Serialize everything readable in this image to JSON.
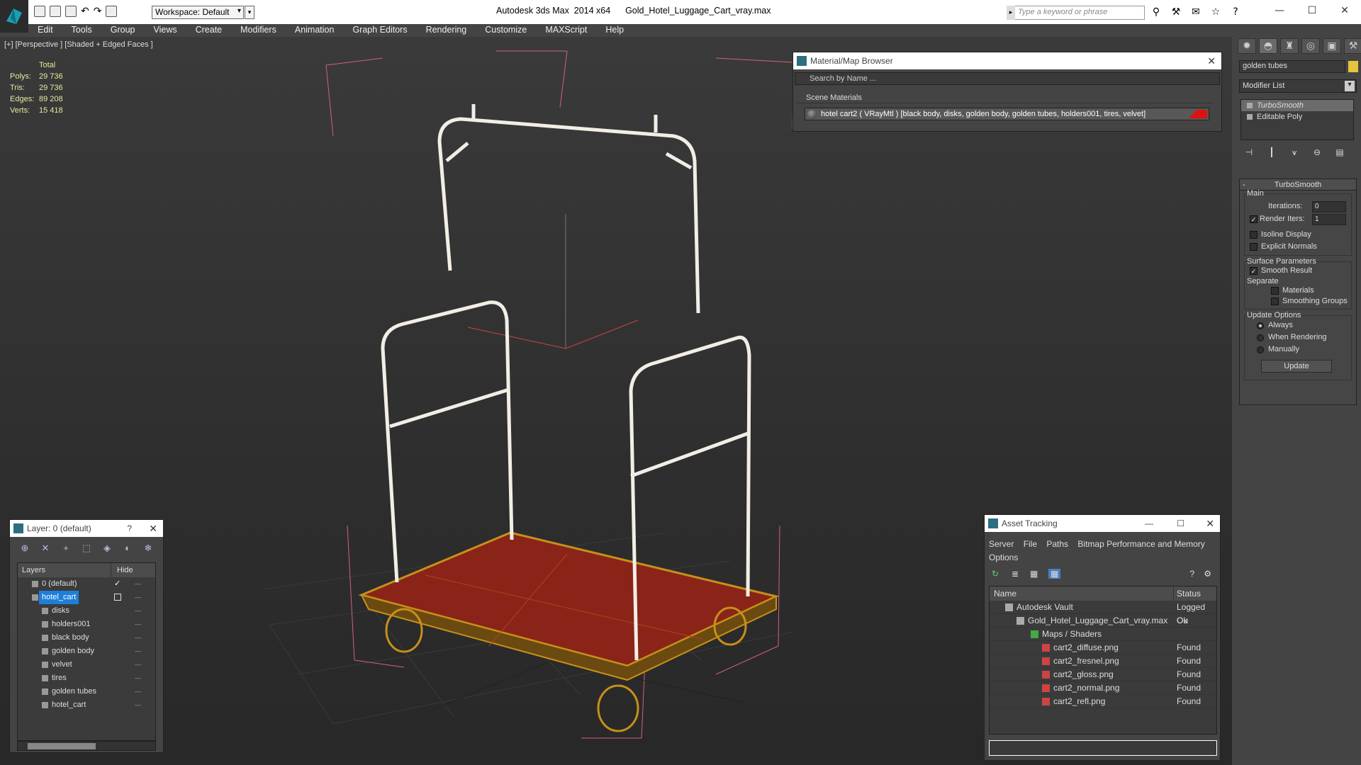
{
  "titlebar": {
    "workspace": "Workspace: Default",
    "app": "Autodesk 3ds Max  2014 x64",
    "file": "Gold_Hotel_Luggage_Cart_vray.max",
    "search_placeholder": "Type a keyword or phrase"
  },
  "menu": [
    "Edit",
    "Tools",
    "Group",
    "Views",
    "Create",
    "Modifiers",
    "Animation",
    "Graph Editors",
    "Rendering",
    "Customize",
    "MAXScript",
    "Help"
  ],
  "viewport": {
    "label": "[+] [Perspective ] [Shaded + Edged Faces ]",
    "stats_header": "Total",
    "stats": [
      {
        "k": "Polys:",
        "v": "29 736"
      },
      {
        "k": "Tris:",
        "v": "29 736"
      },
      {
        "k": "Edges:",
        "v": "89 208"
      },
      {
        "k": "Verts:",
        "v": "15 418"
      }
    ]
  },
  "command_panel": {
    "object_name": "golden tubes",
    "object_color": "#e6c53b",
    "modifier_list": "Modifier List",
    "stack": [
      "TurboSmooth",
      "Editable Poly"
    ],
    "rollout_title": "TurboSmooth",
    "main_label": "Main",
    "iterations_label": "Iterations:",
    "iterations_value": "0",
    "render_iters_label": "Render Iters:",
    "render_iters_value": "1",
    "isoline": "Isoline Display",
    "explicit": "Explicit Normals",
    "surface_label": "Surface Parameters",
    "smooth_result": "Smooth Result",
    "separate_label": "Separate",
    "materials": "Materials",
    "smoothing_groups": "Smoothing Groups",
    "update_label": "Update Options",
    "always": "Always",
    "when_rendering": "When Rendering",
    "manually": "Manually",
    "update_btn": "Update"
  },
  "material_browser": {
    "title": "Material/Map Browser",
    "search": "Search by Name ...",
    "section": "Scene Materials",
    "material": "hotel cart2  ( VRayMtl ) [black body, disks, golden body, golden tubes, holders001, tires, velvet]"
  },
  "layer_window": {
    "title": "Layer: 0 (default)",
    "help": "?",
    "col_layers": "Layers",
    "col_hide": "Hide",
    "rows": [
      "0 (default)",
      "hotel_cart",
      "disks",
      "holders001",
      "black body",
      "golden body",
      "velvet",
      "tires",
      "golden tubes",
      "hotel_cart"
    ]
  },
  "asset_tracking": {
    "title": "Asset Tracking",
    "menu": [
      "Server",
      "File",
      "Paths",
      "Bitmap Performance and Memory",
      "Options"
    ],
    "col_name": "Name",
    "col_status": "Status",
    "rows": [
      {
        "name": "Autodesk Vault",
        "status": "Logged Ou"
      },
      {
        "name": "Gold_Hotel_Luggage_Cart_vray.max",
        "status": "Ok"
      },
      {
        "name": "Maps / Shaders",
        "status": ""
      },
      {
        "name": "cart2_diffuse.png",
        "status": "Found"
      },
      {
        "name": "cart2_fresnel.png",
        "status": "Found"
      },
      {
        "name": "cart2_gloss.png",
        "status": "Found"
      },
      {
        "name": "cart2_normal.png",
        "status": "Found"
      },
      {
        "name": "cart2_refl.png",
        "status": "Found"
      }
    ]
  }
}
